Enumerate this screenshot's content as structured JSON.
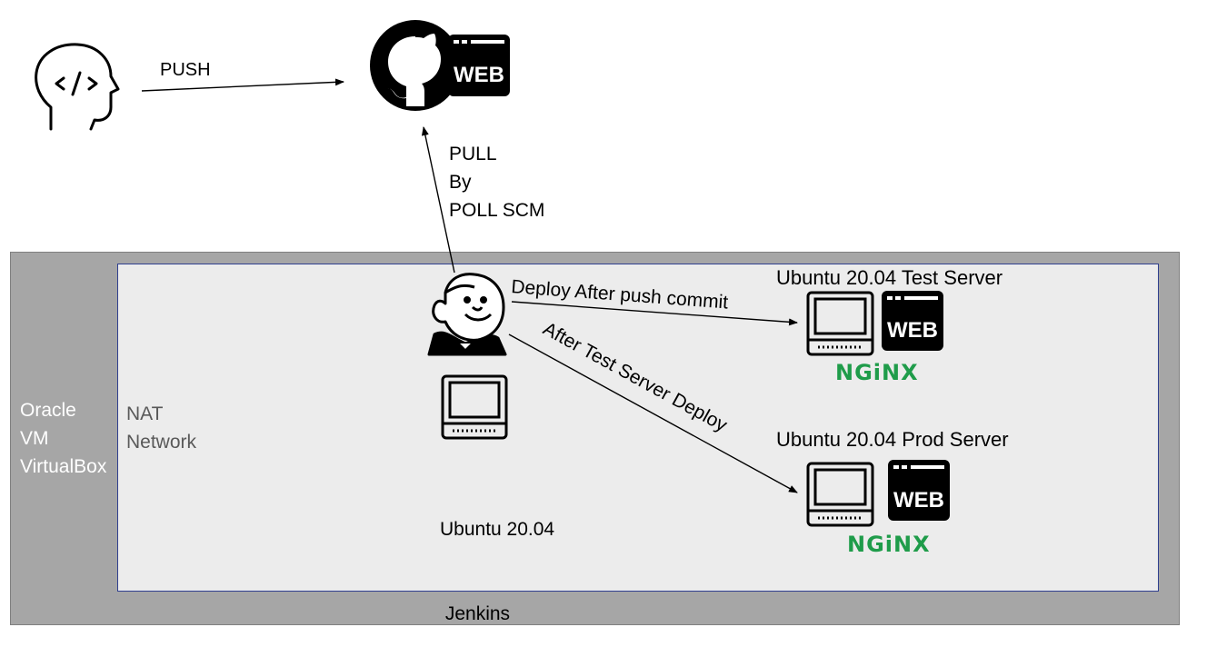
{
  "diagram": {
    "outer_container": {
      "lines": [
        "Oracle",
        "VM",
        "VirtualBox"
      ]
    },
    "inner_container": {
      "lines": [
        "NAT",
        "Network"
      ]
    },
    "edges": {
      "push": "PUSH",
      "pull": [
        "PULL",
        "By",
        "POLL SCM"
      ],
      "deploy_test": "Deploy After push commit",
      "deploy_prod": "After Test Server Deploy"
    },
    "github": {
      "badge": "WEB"
    },
    "jenkins": {
      "lines": [
        "Ubuntu 20.04",
        " Jenkins"
      ]
    },
    "test_server": {
      "title": "Ubuntu 20.04 Test Server",
      "badge": "WEB",
      "brand": "NGiNX"
    },
    "prod_server": {
      "title": "Ubuntu 20.04 Prod Server",
      "badge": "WEB",
      "brand": "NGiNX"
    },
    "colors": {
      "nginx_green": "#1f9c4a",
      "outer_gray": "#a6a6a6",
      "inner_gray": "#ececec",
      "inner_border": "#2f3f8f"
    }
  }
}
